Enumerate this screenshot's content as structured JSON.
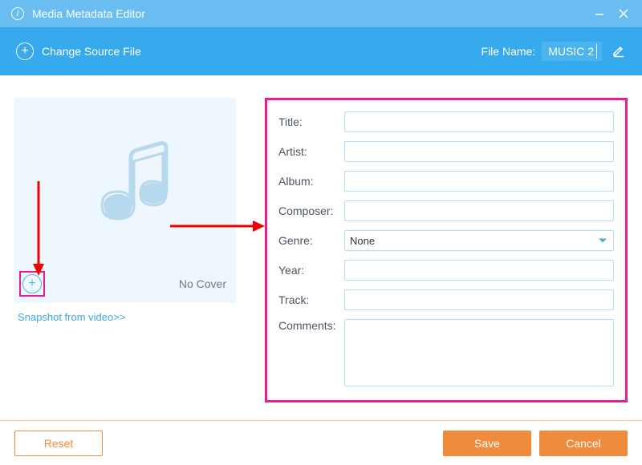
{
  "window": {
    "title": "Media Metadata Editor"
  },
  "subbar": {
    "change_source": "Change Source File",
    "file_name_label": "File Name:",
    "file_name_value": "MUSIC 2"
  },
  "cover": {
    "no_cover": "No Cover",
    "snapshot_link": "Snapshot from video>>"
  },
  "form": {
    "labels": {
      "title": "Title:",
      "artist": "Artist:",
      "album": "Album:",
      "composer": "Composer:",
      "genre": "Genre:",
      "year": "Year:",
      "track": "Track:",
      "comments": "Comments:"
    },
    "values": {
      "title": "",
      "artist": "",
      "album": "",
      "composer": "",
      "genre": "None",
      "year": "",
      "track": "",
      "comments": ""
    }
  },
  "footer": {
    "reset": "Reset",
    "save": "Save",
    "cancel": "Cancel"
  },
  "colors": {
    "accent": "#37a9ed",
    "brand_light": "#69bdf1",
    "primary_btn": "#f08b3c",
    "highlight_box": "#e81b9a"
  }
}
